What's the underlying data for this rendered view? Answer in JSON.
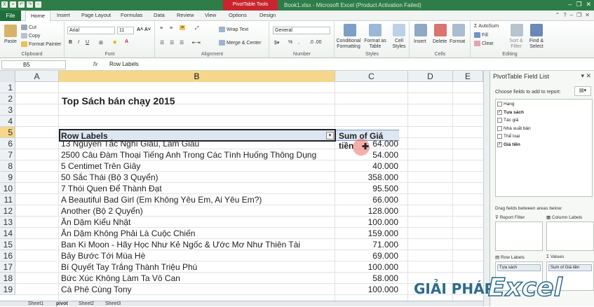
{
  "app": {
    "title": "Book1.xlsx - Microsoft Excel (Product Activation Failed)",
    "context_tab": "PivotTable Tools"
  },
  "ribbon": {
    "tabs": [
      "File",
      "Home",
      "Insert",
      "Page Layout",
      "Formulas",
      "Data",
      "Review",
      "View",
      "Options",
      "Design"
    ],
    "clipboard": {
      "paste": "Paste",
      "cut": "Cut",
      "copy": "Copy",
      "format_painter": "Format Painter",
      "label": "Clipboard"
    },
    "font": {
      "name": "Arial",
      "size": "11",
      "label": "Font"
    },
    "alignment": {
      "wrap": "Wrap Text",
      "merge": "Merge & Center",
      "label": "Alignment"
    },
    "number": {
      "format": "General",
      "label": "Number"
    },
    "styles": {
      "conditional": "Conditional Formatting",
      "table": "Format as Table",
      "cell": "Cell Styles",
      "label": "Styles"
    },
    "cells": {
      "insert": "Insert",
      "delete": "Delete",
      "format": "Format",
      "label": "Cells"
    },
    "editing": {
      "autosum": "AutoSum",
      "fill": "Fill",
      "clear": "Clear",
      "sort": "Sort & Filter",
      "find": "Find & Select",
      "label": "Editing"
    }
  },
  "formula_bar": {
    "name_box": "B5",
    "fx": "fx",
    "content": "Row Labels"
  },
  "grid": {
    "columns": [
      "A",
      "B",
      "C",
      "D",
      "E"
    ],
    "rows": [
      "1",
      "2",
      "3",
      "4",
      "5",
      "6",
      "7",
      "8",
      "9",
      "10",
      "11",
      "12",
      "13",
      "14",
      "15",
      "16",
      "17",
      "18",
      "19"
    ],
    "title": "Top Sách bán chạy 2015",
    "header_label": "Row Labels",
    "header_sum": "Sum of Giá tiền",
    "data": [
      {
        "name": "13 Nguyên Tắc Nghĩ Giàu, Làm Giàu",
        "value": "64.000"
      },
      {
        "name": "2500 Câu Đàm Thoại Tiếng Anh Trong Các Tình Huống Thông Dụng",
        "value": "54.000"
      },
      {
        "name": "5 Centimet Trên Giây",
        "value": "40.000"
      },
      {
        "name": "50 Sắc Thái (Bộ 3 Quyển)",
        "value": "358.000"
      },
      {
        "name": "7 Thói Quen Để Thành Đạt",
        "value": "95.500"
      },
      {
        "name": "A Beautiful Bad Girl (Em Không Yêu Em, Ai Yêu Em?)",
        "value": "66.000"
      },
      {
        "name": "Another (Bộ 2 Quyển)",
        "value": "128.000"
      },
      {
        "name": "Ăn Dặm Kiểu Nhật",
        "value": "100.000"
      },
      {
        "name": "Ăn Dặm Không Phải Là Cuộc Chiến",
        "value": "159.000"
      },
      {
        "name": "Ban Ki Moon - Hãy Học Như Kẻ Ngốc & Ước Mơ Như Thiên Tài",
        "value": "71.000"
      },
      {
        "name": "Bảy Bước Tới Mùa Hè",
        "value": "69.000"
      },
      {
        "name": "Bí Quyết Tay Trắng Thành Triệu Phú",
        "value": "100.000"
      },
      {
        "name": "Bức Xúc Không Làm Ta Vô Can",
        "value": "58.000"
      },
      {
        "name": "Cà Phê Cùng Tony",
        "value": "100.000"
      }
    ]
  },
  "sheets": [
    "Sheet1",
    "pivot",
    "Sheet2",
    "Sheet3"
  ],
  "panel": {
    "title": "PivotTable Field List",
    "choose_label": "Choose fields to add to report:",
    "fields": [
      {
        "label": "Hạng",
        "checked": false
      },
      {
        "label": "Tựa sách",
        "checked": true
      },
      {
        "label": "Tác giả",
        "checked": false
      },
      {
        "label": "Nhà xuất bản",
        "checked": false
      },
      {
        "label": "Thể loại",
        "checked": false
      },
      {
        "label": "Giá tiền",
        "checked": true
      }
    ],
    "drag_label": "Drag fields between areas below:",
    "report_filter": "Report Filter",
    "column_labels": "Column Labels",
    "row_labels": "Row Labels",
    "values": "Values",
    "row_item": "Tựa sách",
    "value_item": "Sum of Giá tiền"
  },
  "watermark": {
    "left": "GIẢI PHÁP",
    "right": "Excel"
  },
  "colors": {
    "title_green": "#2e7d48",
    "context_red": "#c9252d",
    "selected_header": "#f5d68a",
    "pivot_header": "#dde6f1"
  }
}
